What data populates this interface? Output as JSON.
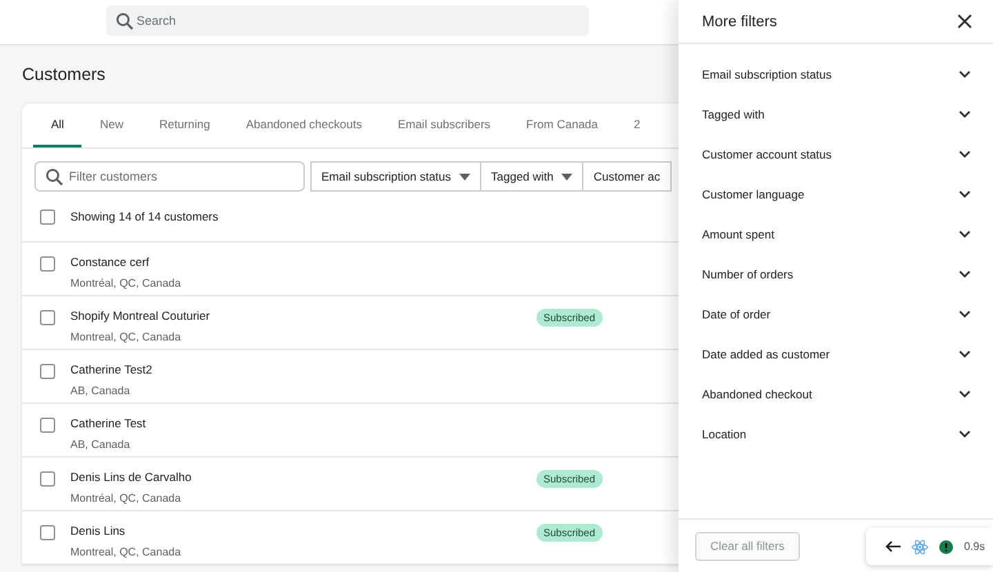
{
  "search": {
    "placeholder": "Search"
  },
  "page_title": "Customers",
  "tabs": [
    {
      "label": "All",
      "selected": true
    },
    {
      "label": "New",
      "selected": false
    },
    {
      "label": "Returning",
      "selected": false
    },
    {
      "label": "Abandoned checkouts",
      "selected": false
    },
    {
      "label": "Email subscribers",
      "selected": false
    },
    {
      "label": "From Canada",
      "selected": false
    },
    {
      "label": "2",
      "selected": false
    }
  ],
  "filter_field": {
    "placeholder": "Filter customers"
  },
  "filter_buttons": [
    "Email subscription status",
    "Tagged with",
    "Customer ac"
  ],
  "select_all": {
    "label": "Showing 14 of 14 customers",
    "checked": false
  },
  "customers": [
    {
      "name": "Constance cerf",
      "location": "Montréal, QC, Canada",
      "checked": false
    },
    {
      "name": "Shopify Montreal Couturier",
      "location": "Montreal, QC, Canada",
      "badge": "Subscribed",
      "checked": false
    },
    {
      "name": "Catherine Test2",
      "location": "AB, Canada",
      "checked": false
    },
    {
      "name": "Catherine Test",
      "location": "AB, Canada",
      "checked": false
    },
    {
      "name": "Denis Lins de Carvalho",
      "location": "Montréal, QC, Canada",
      "badge": "Subscribed",
      "checked": false
    },
    {
      "name": "Denis Lins",
      "location": "Montreal, QC, Canada",
      "badge": "Subscribed",
      "checked": false
    }
  ],
  "panel": {
    "title": "More filters",
    "filters": [
      "Email subscription status",
      "Tagged with",
      "Customer account status",
      "Customer language",
      "Amount spent",
      "Number of orders",
      "Date of order",
      "Date added as customer",
      "Abandoned checkout",
      "Location"
    ],
    "clear_button": {
      "label": "Clear all filters",
      "disabled": true
    }
  },
  "dev_overlay": {
    "time": "0.9s"
  }
}
